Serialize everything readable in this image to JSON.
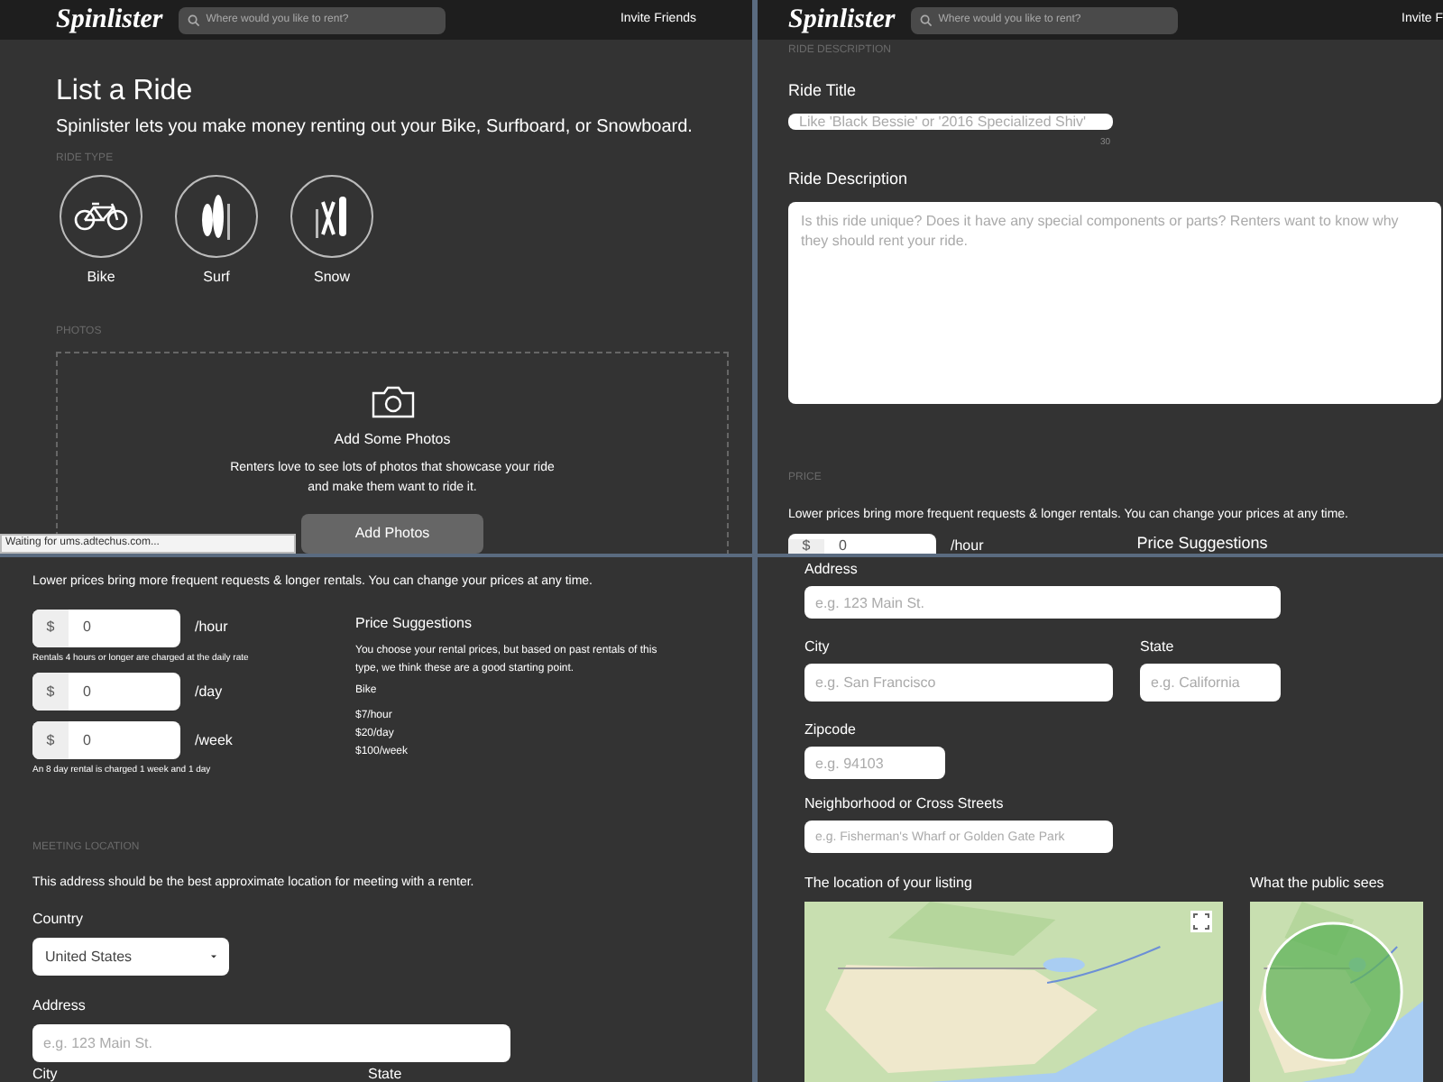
{
  "list_ride_panel": {
    "header": {
      "logo": "Spinlister",
      "search_placeholder": "Where would you like to rent?",
      "invite": "Invite Friends"
    },
    "title": "List a Ride",
    "subtitle": "Spinlister lets you make money renting out your Bike, Surfboard, or Snowboard.",
    "ride_type_heading": "RIDE TYPE",
    "ride_types": [
      {
        "kind": "bike",
        "label": "Bike"
      },
      {
        "kind": "surf",
        "label": "Surf"
      },
      {
        "kind": "snow",
        "label": "Snow"
      }
    ],
    "photos_heading": "PHOTOS",
    "photos": {
      "title": "Add Some Photos",
      "text": "Renters love to see lots of photos that showcase your ride and make them want to ride it.",
      "button": "Add Photos"
    },
    "status_bar": "Waiting for ums.adtechus.com..."
  },
  "description_panel": {
    "header": {
      "logo": "Spinlister",
      "search_placeholder": "Where would you like to rent?",
      "invite": "Invite F"
    },
    "section_heading": "RIDE DESCRIPTION",
    "title_label": "Ride Title",
    "title_placeholder": "Like 'Black Bessie' or '2016 Specialized Shiv'",
    "title_counter": "30",
    "description_label": "Ride Description",
    "description_placeholder": "Is this ride unique? Does it have any special components or parts? Renters want to know why they should rent your ride.",
    "price_heading": "PRICE",
    "price_text": "Lower prices bring more frequent requests & longer rentals. You can change your prices at any time.",
    "price_preview": {
      "currency": "$",
      "value": "0",
      "unit": "/hour",
      "suggestions_title": "Price Suggestions"
    }
  },
  "price_panel": {
    "text": "Lower prices bring more frequent requests & longer rentals. You can change your prices at any time.",
    "rates": [
      {
        "currency": "$",
        "value": "0",
        "unit": "/hour",
        "note": "Rentals 4 hours or longer are charged at the daily rate"
      },
      {
        "currency": "$",
        "value": "0",
        "unit": "/day"
      },
      {
        "currency": "$",
        "value": "0",
        "unit": "/week",
        "note": "An 8 day rental is charged 1 week and 1 day"
      }
    ],
    "suggestions": {
      "title": "Price Suggestions",
      "text": "You choose your rental prices, but based on past rentals of this type, we think these are a good starting point.",
      "type": "Bike",
      "prices": [
        "$7/hour",
        "$20/day",
        "$100/week"
      ]
    },
    "meeting_heading": "MEETING LOCATION",
    "meeting_text": "This address should be the best approximate location for meeting with a renter.",
    "country_label": "Country",
    "country_value": "United States",
    "address_label": "Address",
    "address_placeholder": "e.g. 123 Main St.",
    "city_label": "City",
    "state_label": "State"
  },
  "location_panel": {
    "address_label": "Address",
    "address_placeholder": "e.g. 123 Main St.",
    "city_label": "City",
    "city_placeholder": "e.g. San Francisco",
    "state_label": "State",
    "state_placeholder": "e.g. California",
    "zip_label": "Zipcode",
    "zip_placeholder": "e.g. 94103",
    "neighborhood_label": "Neighborhood or Cross Streets",
    "neighborhood_placeholder": "e.g. Fisherman's Wharf or Golden Gate Park",
    "map_label": "The location of your listing",
    "public_label": "What the public sees"
  }
}
